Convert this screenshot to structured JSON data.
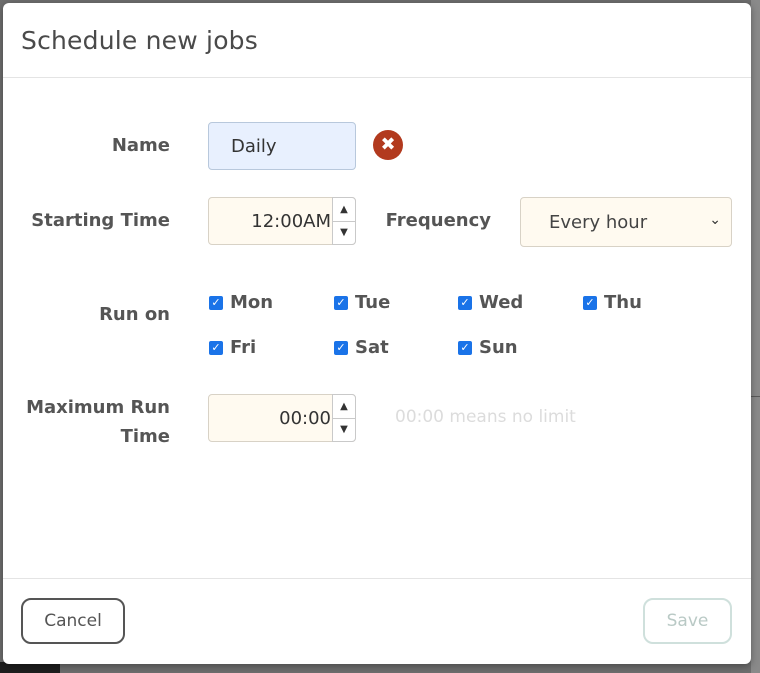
{
  "dialog": {
    "title": "Schedule new jobs"
  },
  "form": {
    "name_label": "Name",
    "name_value": "Daily",
    "starting_time_label": "Starting Time",
    "starting_time_value": "12:00AM",
    "frequency_label": "Frequency",
    "frequency_value": "Every hour",
    "run_on_label": "Run on",
    "days": [
      {
        "label": "Mon",
        "checked": true
      },
      {
        "label": "Tue",
        "checked": true
      },
      {
        "label": "Wed",
        "checked": true
      },
      {
        "label": "Thu",
        "checked": true
      },
      {
        "label": "Fri",
        "checked": true
      },
      {
        "label": "Sat",
        "checked": true
      },
      {
        "label": "Sun",
        "checked": true
      }
    ],
    "max_run_label_line1": "Maximum Run",
    "max_run_label_line2": "Time",
    "max_run_value": "00:00",
    "max_run_hint": "00:00 means no limit"
  },
  "footer": {
    "cancel_label": "Cancel",
    "save_label": "Save"
  },
  "colors": {
    "checkbox": "#1a73e8",
    "clear_icon": "#b23a1e",
    "name_field_bg": "#e8f0fe",
    "input_bg": "#fffaf0"
  }
}
